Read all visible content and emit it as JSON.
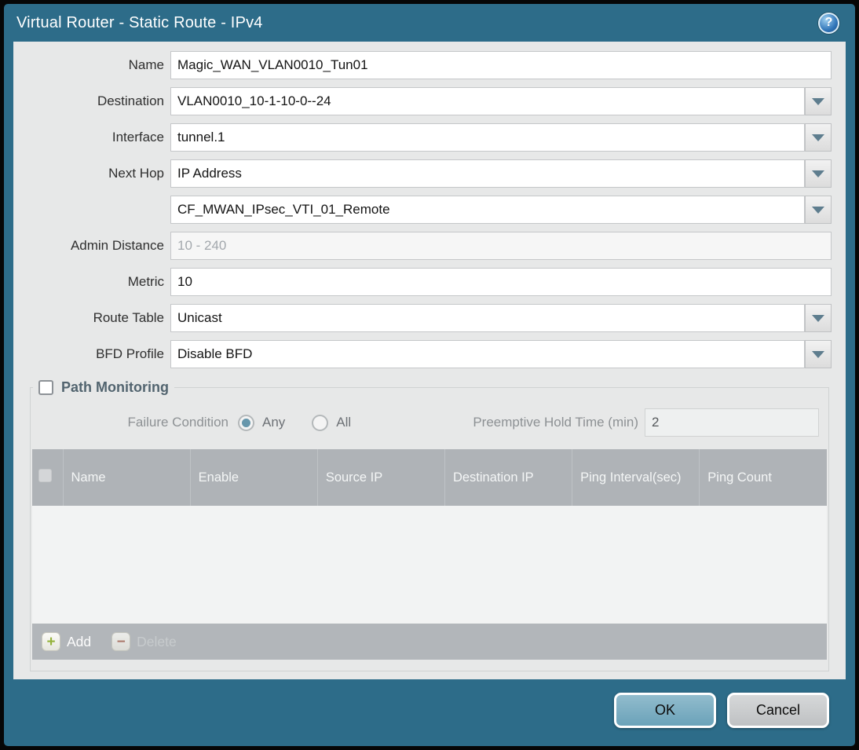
{
  "dialog": {
    "title": "Virtual Router - Static Route - IPv4",
    "colors": {
      "accent": "#2d6c89",
      "panel": "#e7e8e8",
      "table_header": "#afb3b7",
      "ok_button": "#7badc2"
    }
  },
  "icons": {
    "help": "?",
    "plus": "+",
    "minus": "−",
    "chevron": "▼"
  },
  "form": {
    "fields": [
      {
        "label": "Name",
        "value": "Magic_WAN_VLAN0010_Tun01"
      },
      {
        "label": "Destination",
        "value": "VLAN0010_10-1-10-0--24"
      },
      {
        "label": "Interface",
        "value": "tunnel.1"
      },
      {
        "label": "Next Hop",
        "value": "IP Address"
      },
      {
        "label": "",
        "value": "CF_MWAN_IPsec_VTI_01_Remote"
      },
      {
        "label": "Admin Distance",
        "value": "",
        "placeholder": "10 - 240"
      },
      {
        "label": "Metric",
        "value": "10"
      },
      {
        "label": "Route Table",
        "value": "Unicast"
      },
      {
        "label": "BFD Profile",
        "value": "Disable BFD"
      }
    ]
  },
  "path_monitoring": {
    "title": "Path Monitoring",
    "checked": false,
    "failure_condition": {
      "label": "Failure Condition",
      "options": [
        "Any",
        "All"
      ],
      "selected": "Any"
    },
    "preemptive_hold": {
      "label": "Preemptive Hold Time (min)",
      "value": "2"
    },
    "table": {
      "columns": [
        "Name",
        "Enable",
        "Source IP",
        "Destination IP",
        "Ping Interval(sec)",
        "Ping Count"
      ],
      "rows": []
    },
    "actions": {
      "add": "Add",
      "delete": "Delete"
    }
  },
  "footer": {
    "ok": "OK",
    "cancel": "Cancel"
  }
}
